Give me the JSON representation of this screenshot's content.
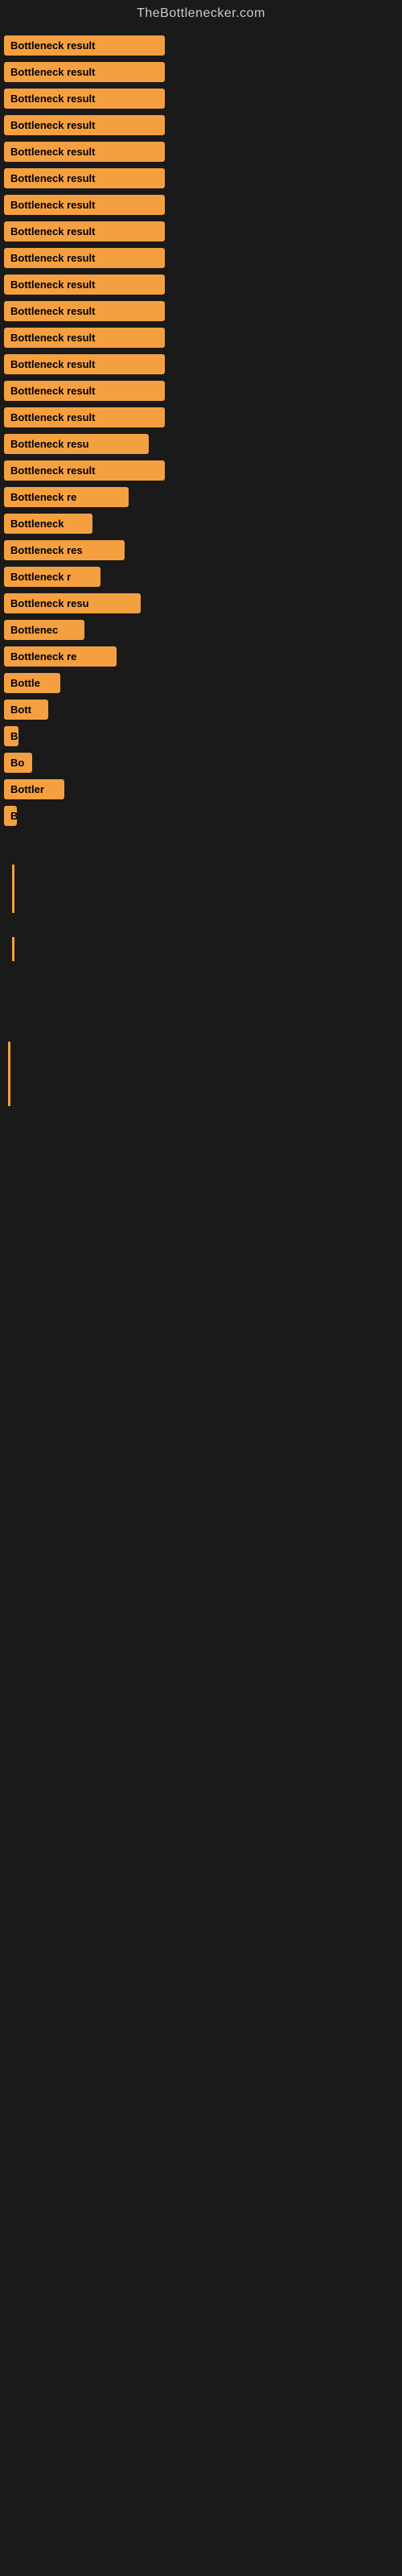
{
  "site": {
    "title": "TheBottlenecker.com"
  },
  "results": [
    {
      "id": 1,
      "label": "Bottleneck result",
      "width_class": "w-full"
    },
    {
      "id": 2,
      "label": "Bottleneck result",
      "width_class": "w-full"
    },
    {
      "id": 3,
      "label": "Bottleneck result",
      "width_class": "w-full"
    },
    {
      "id": 4,
      "label": "Bottleneck result",
      "width_class": "w-full"
    },
    {
      "id": 5,
      "label": "Bottleneck result",
      "width_class": "w-full"
    },
    {
      "id": 6,
      "label": "Bottleneck result",
      "width_class": "w-full"
    },
    {
      "id": 7,
      "label": "Bottleneck result",
      "width_class": "w-full"
    },
    {
      "id": 8,
      "label": "Bottleneck result",
      "width_class": "w-full"
    },
    {
      "id": 9,
      "label": "Bottleneck result",
      "width_class": "w-full"
    },
    {
      "id": 10,
      "label": "Bottleneck result",
      "width_class": "w-full"
    },
    {
      "id": 11,
      "label": "Bottleneck result",
      "width_class": "w-full"
    },
    {
      "id": 12,
      "label": "Bottleneck result",
      "width_class": "w-full"
    },
    {
      "id": 13,
      "label": "Bottleneck result",
      "width_class": "w-full"
    },
    {
      "id": 14,
      "label": "Bottleneck result",
      "width_class": "w-full"
    },
    {
      "id": 15,
      "label": "Bottleneck result",
      "width_class": "w-full"
    },
    {
      "id": 16,
      "label": "Bottleneck resu",
      "width_class": "w-lg"
    },
    {
      "id": 17,
      "label": "Bottleneck result",
      "width_class": "w-full"
    },
    {
      "id": 18,
      "label": "Bottleneck re",
      "width_class": "w-md"
    },
    {
      "id": 19,
      "label": "Bottleneck",
      "width_class": "w-sm"
    },
    {
      "id": 20,
      "label": "Bottleneck res",
      "width_class": "w-md"
    },
    {
      "id": 21,
      "label": "Bottleneck r",
      "width_class": "w-sm"
    },
    {
      "id": 22,
      "label": "Bottleneck resu",
      "width_class": "w-lg"
    },
    {
      "id": 23,
      "label": "Bottlenec",
      "width_class": "w-sm"
    },
    {
      "id": 24,
      "label": "Bottleneck re",
      "width_class": "w-md"
    },
    {
      "id": 25,
      "label": "Bottle",
      "width_class": "w-xs"
    },
    {
      "id": 26,
      "label": "Bott",
      "width_class": "w-xs"
    },
    {
      "id": 27,
      "label": "B",
      "width_class": "w-xxs"
    },
    {
      "id": 28,
      "label": "Bo",
      "width_class": "w-xxs"
    },
    {
      "id": 29,
      "label": "Bottler",
      "width_class": "w-xs"
    },
    {
      "id": 30,
      "label": "B",
      "width_class": "w-tiny"
    }
  ],
  "bars": [
    {
      "id": 1,
      "type": "vertical"
    },
    {
      "id": 2,
      "type": "small"
    }
  ]
}
